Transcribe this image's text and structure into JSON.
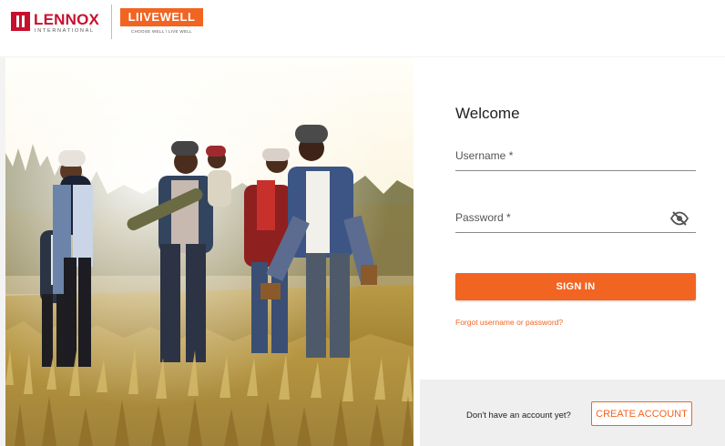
{
  "header": {
    "lennox_name": "LENNOX",
    "lennox_subtitle": "INTERNATIONAL",
    "livewell_name": "LIIVEWELL",
    "livewell_tagline": "CHOOSE WELL \\ LIVE WELL"
  },
  "form": {
    "welcome": "Welcome",
    "username_label": "Username *",
    "password_label": "Password *",
    "signin_label": "SIGN IN",
    "forgot_label": "Forgot username or password?"
  },
  "footer": {
    "prompt": "Don't have an account yet?",
    "create_label": "CREATE ACCOUNT"
  },
  "colors": {
    "brand_orange": "#f26422",
    "lennox_red": "#c8102e"
  },
  "icons": {
    "password_toggle": "eye-off-icon"
  }
}
